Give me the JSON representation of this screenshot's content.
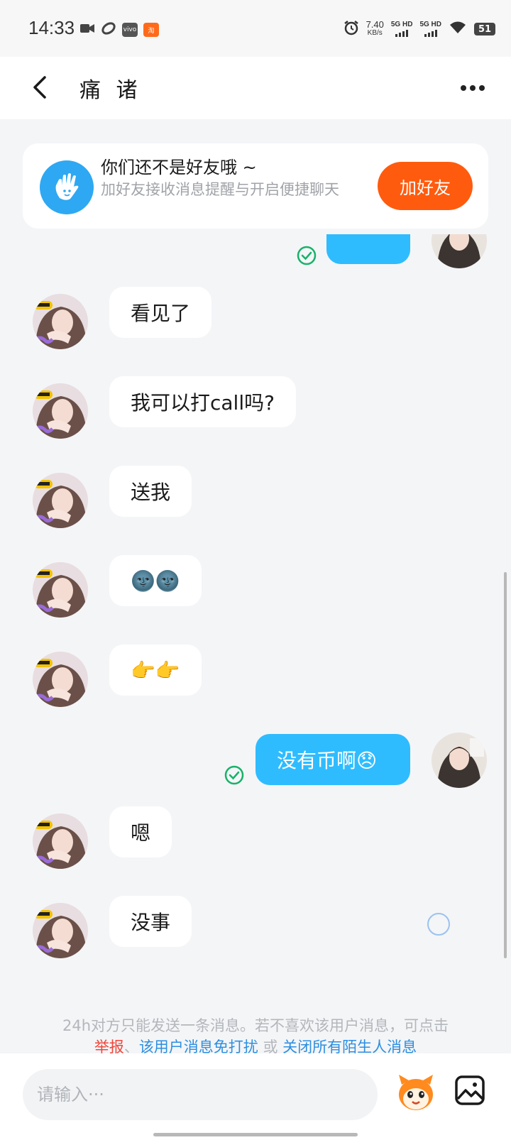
{
  "status_bar": {
    "time": "14:33",
    "speed_value": "7.40",
    "speed_unit": "KB/s",
    "sim1": "5G HD",
    "sim2": "5G HD",
    "battery": "51",
    "icons": [
      "video-icon",
      "link-icon",
      "vivo-icon",
      "taobao-icon",
      "alarm-icon",
      "signal-icon",
      "wifi-icon",
      "battery-icon"
    ]
  },
  "header": {
    "title": "痛 诸",
    "back_icon": "chevron-left-icon",
    "more_icon": "more-dots-icon"
  },
  "banner": {
    "title": "你们还不是好友哦 ~",
    "subtitle": "加好友接收消息提醒与开启便捷聊天",
    "button_label": "加好友",
    "button_color": "#ff5b0e"
  },
  "messages": [
    {
      "side": "out",
      "text": "",
      "status": "sent",
      "partial": true
    },
    {
      "side": "in",
      "text": "看见了"
    },
    {
      "side": "in",
      "text": "我可以打call吗?"
    },
    {
      "side": "in",
      "text": "送我"
    },
    {
      "side": "in",
      "text": "🌚🌚"
    },
    {
      "side": "in",
      "text": "👉👉"
    },
    {
      "side": "out",
      "text": "没有币啊😞",
      "status": "sent"
    },
    {
      "side": "in",
      "text": "嗯"
    },
    {
      "side": "in",
      "text": "没事"
    }
  ],
  "notice": {
    "line1": "24h对方只能发送一条消息。若不喜欢该用户消息，可点击",
    "report": "举报",
    "sep1": "、",
    "mute": "该用户消息免打扰",
    "or": " 或 ",
    "close_all": "关闭所有陌生人消息"
  },
  "input": {
    "placeholder": "请输入···"
  },
  "colors": {
    "accent_blue": "#2ebcff",
    "background": "#f4f5f7",
    "sent_check": "#17b26a",
    "link_red": "#f0463a",
    "link_blue": "#2c8fe0"
  }
}
